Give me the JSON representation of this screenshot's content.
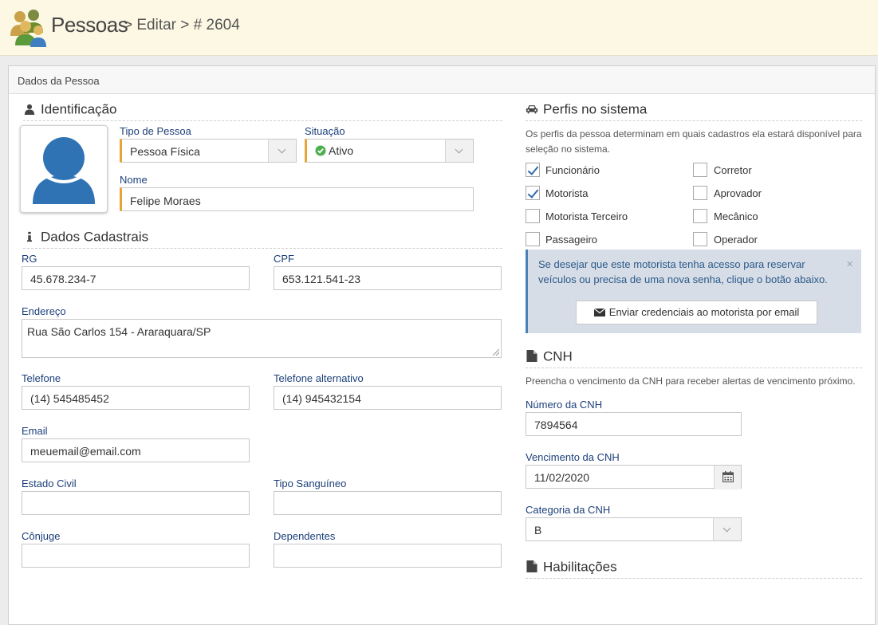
{
  "header": {
    "title": "Pessoas",
    "breadcrumb": "> Editar > # 2604"
  },
  "panel": {
    "title": "Dados da Pessoa"
  },
  "identificacao": {
    "title": "Identificação",
    "tipo_pessoa": {
      "label": "Tipo de Pessoa",
      "value": "Pessoa Física"
    },
    "situacao": {
      "label": "Situação",
      "value": "Ativo"
    },
    "nome": {
      "label": "Nome",
      "value": "Felipe Moraes"
    }
  },
  "cadastrais": {
    "title": "Dados Cadastrais",
    "rg": {
      "label": "RG",
      "value": "45.678.234-7"
    },
    "cpf": {
      "label": "CPF",
      "value": "653.121.541-23"
    },
    "endereco": {
      "label": "Endereço",
      "value": "Rua São Carlos 154 - Araraquara/SP"
    },
    "telefone": {
      "label": "Telefone",
      "value": "(14) 545485452"
    },
    "telefone_alt": {
      "label": "Telefone alternativo",
      "value": "(14) 945432154"
    },
    "email": {
      "label": "Email",
      "value": "meuemail@email.com"
    },
    "estado_civil": {
      "label": "Estado Civil",
      "value": ""
    },
    "tipo_sanguineo": {
      "label": "Tipo Sanguíneo",
      "value": ""
    },
    "conjuge": {
      "label": "Cônjuge",
      "value": ""
    },
    "dependentes": {
      "label": "Dependentes",
      "value": ""
    }
  },
  "perfis": {
    "title": "Perfis no sistema",
    "description": "Os perfis da pessoa determinam em quais cadastros ela estará disponível para seleção no sistema.",
    "items": [
      {
        "label": "Funcionário",
        "checked": true
      },
      {
        "label": "Corretor",
        "checked": false
      },
      {
        "label": "Motorista",
        "checked": true
      },
      {
        "label": "Aprovador",
        "checked": false
      },
      {
        "label": "Motorista Terceiro",
        "checked": false
      },
      {
        "label": "Mecânico",
        "checked": false
      },
      {
        "label": "Passageiro",
        "checked": false
      },
      {
        "label": "Operador",
        "checked": false
      }
    ],
    "alert": {
      "message": "Se desejar que este motorista tenha acesso para reservar veículos ou precisa de uma nova senha, clique o botão abaixo.",
      "button": "Enviar credenciais ao motorista por email",
      "close": "×"
    }
  },
  "cnh": {
    "title": "CNH",
    "description": "Preencha o vencimento da CNH para receber alertas de vencimento próximo.",
    "numero": {
      "label": "Número da CNH",
      "value": "7894564"
    },
    "vencimento": {
      "label": "Vencimento da CNH",
      "value": "11/02/2020"
    },
    "categoria": {
      "label": "Categoria da CNH",
      "value": "B"
    }
  },
  "habilitacoes": {
    "title": "Habilitações"
  },
  "colors": {
    "accent": "#e8a33a",
    "label": "#1b3f7a",
    "check": "#2f6aa8",
    "active": "#4caf50"
  }
}
